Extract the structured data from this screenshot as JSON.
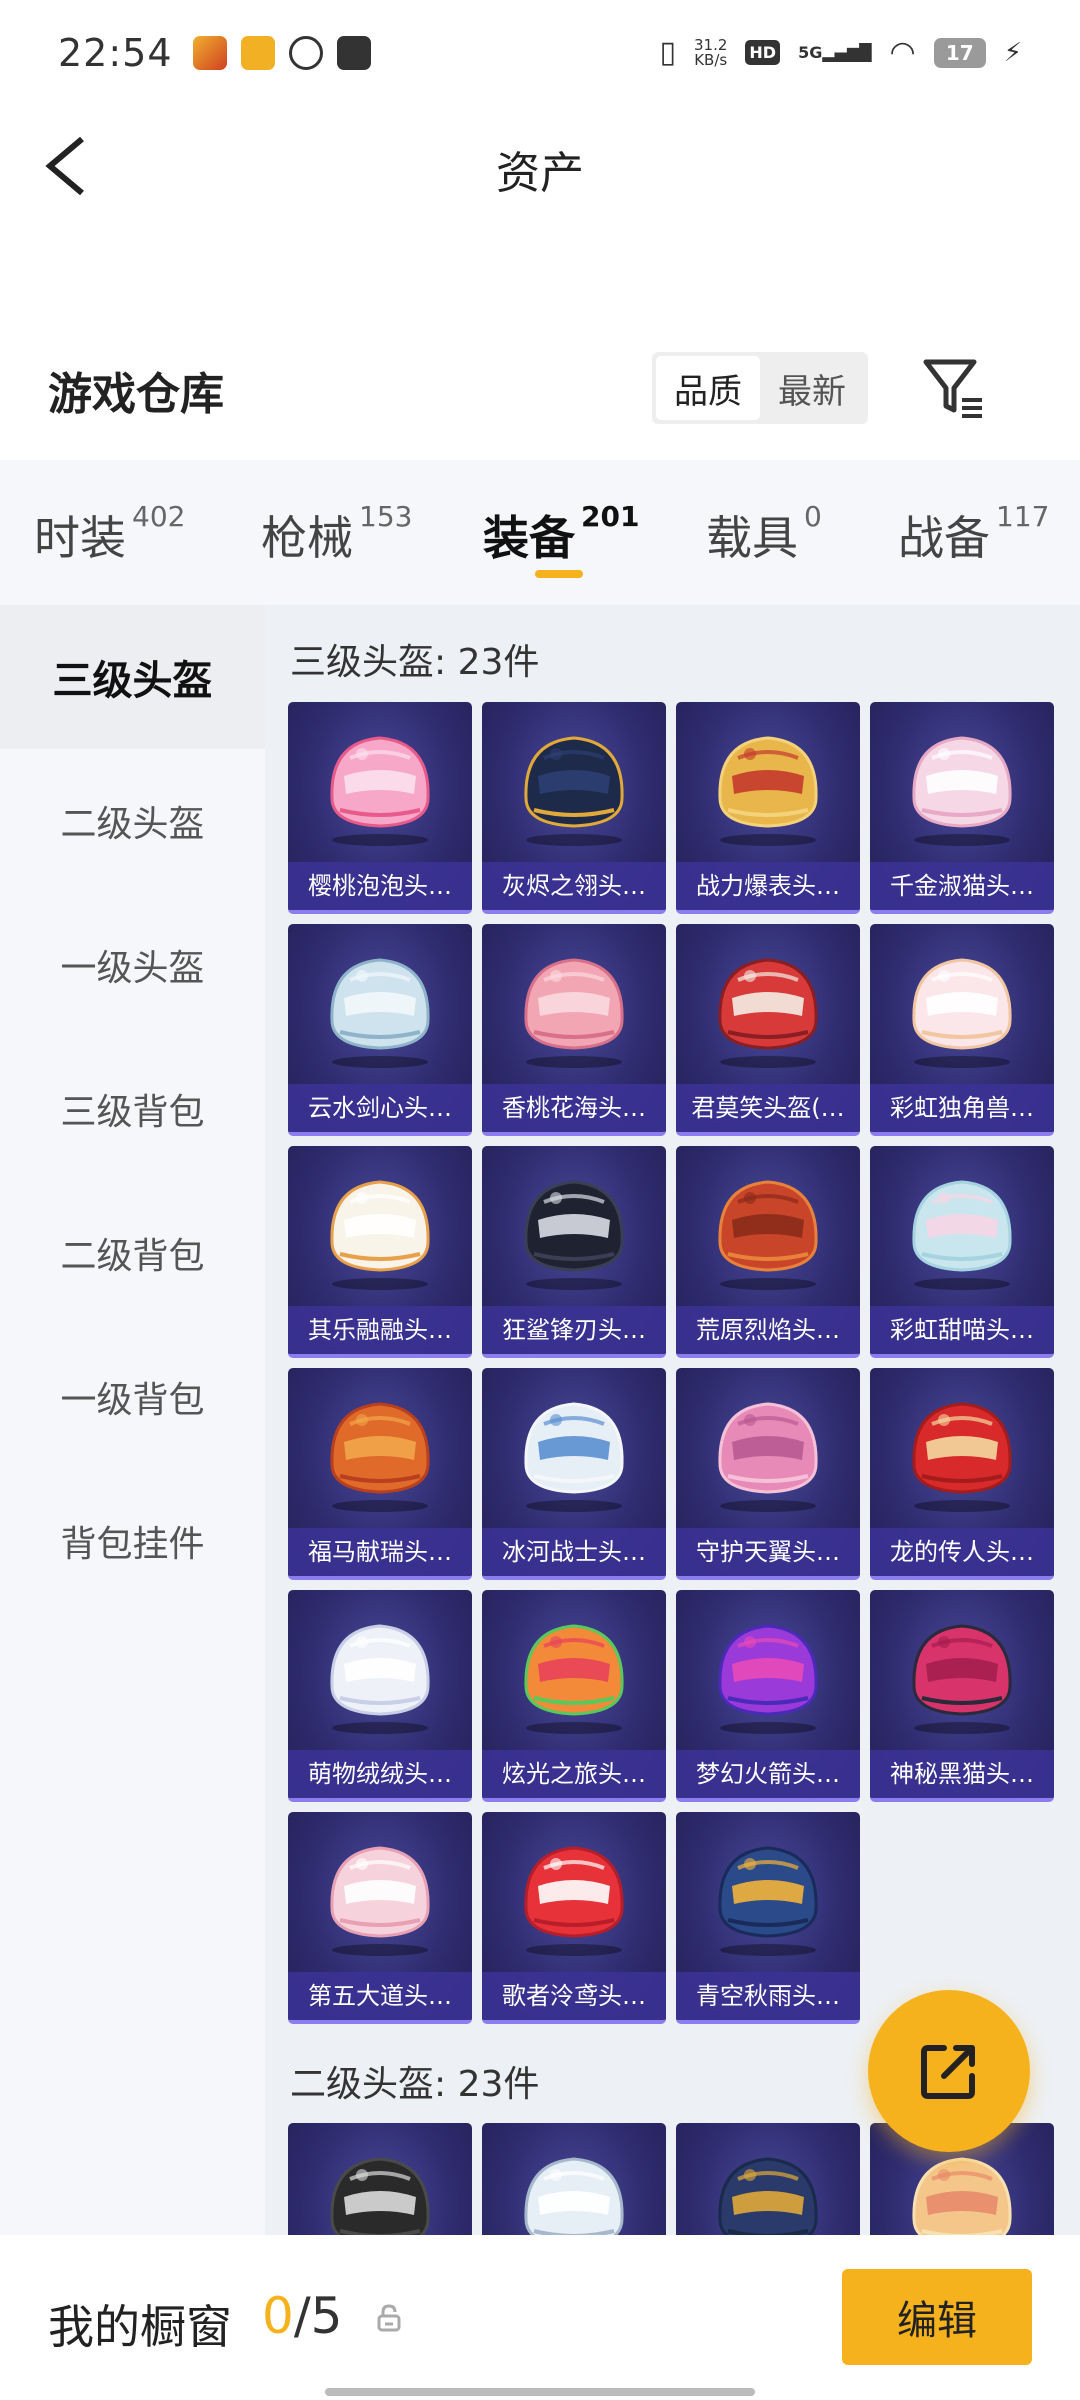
{
  "status_bar": {
    "time": "22:54",
    "net_speed_value": "31.2",
    "net_speed_unit": "KB/s",
    "hd_label": "HD",
    "signal_label": "5G",
    "battery_level": "17"
  },
  "header": {
    "title": "资产"
  },
  "warehouse": {
    "title": "游戏仓库",
    "sort_options": [
      "品质",
      "最新"
    ],
    "sort_selected": "品质"
  },
  "category_tabs": [
    {
      "label": "时装",
      "count": "402"
    },
    {
      "label": "枪械",
      "count": "153"
    },
    {
      "label": "装备",
      "count": "201"
    },
    {
      "label": "载具",
      "count": "0"
    },
    {
      "label": "战备",
      "count": "117"
    }
  ],
  "active_category": "装备",
  "sidebar": {
    "items": [
      "三级头盔",
      "二级头盔",
      "一级头盔",
      "三级背包",
      "二级背包",
      "一级背包",
      "背包挂件"
    ],
    "active": "三级头盔"
  },
  "sections": [
    {
      "title": "三级头盔: 23件",
      "items": [
        {
          "name": "樱桃泡泡头…",
          "colors": [
            "#f7a8c8",
            "#fbe0ec",
            "#e85a8a"
          ]
        },
        {
          "name": "灰烬之翎头…",
          "colors": [
            "#1d2a4a",
            "#2d3f72",
            "#e0a93a"
          ]
        },
        {
          "name": "战力爆表头…",
          "colors": [
            "#e8b64a",
            "#c43a2e",
            "#f4d27a"
          ]
        },
        {
          "name": "千金淑猫头…",
          "colors": [
            "#f6d7e6",
            "#ffffff",
            "#e8a9c4"
          ]
        },
        {
          "name": "云水剑心头…",
          "colors": [
            "#cfe3ef",
            "#f1f7fb",
            "#8fb3c9"
          ]
        },
        {
          "name": "香桃花海头…",
          "colors": [
            "#f2a6b4",
            "#fbd9df",
            "#d8708a"
          ]
        },
        {
          "name": "君莫笑头盔(…",
          "colors": [
            "#d83a3a",
            "#f4ede4",
            "#8a1e22"
          ]
        },
        {
          "name": "彩虹独角兽…",
          "colors": [
            "#fbe6ea",
            "#ffffff",
            "#f2c6a0"
          ]
        },
        {
          "name": "其乐融融头…",
          "colors": [
            "#f8f4ea",
            "#ffffff",
            "#e8a04a"
          ]
        },
        {
          "name": "狂鲨锋刃头…",
          "colors": [
            "#1f2230",
            "#d9dde6",
            "#3a3f55"
          ]
        },
        {
          "name": "荒原烈焰头…",
          "colors": [
            "#c8452a",
            "#8a2a1a",
            "#e8823a"
          ]
        },
        {
          "name": "彩虹甜喵头…",
          "colors": [
            "#c9e6ee",
            "#f6d6e6",
            "#a5d3e0"
          ]
        },
        {
          "name": "福马献瑞头…",
          "colors": [
            "#e06a2a",
            "#f2a64a",
            "#b8401e"
          ]
        },
        {
          "name": "冰河战士头…",
          "colors": [
            "#e6eef6",
            "#5a8fd0",
            "#f4f6f9"
          ]
        },
        {
          "name": "守护天翼头…",
          "colors": [
            "#e88ab8",
            "#b85a92",
            "#f4c1d8"
          ]
        },
        {
          "name": "龙的传人头…",
          "colors": [
            "#d82a2a",
            "#f4d9a0",
            "#a51c1c"
          ]
        },
        {
          "name": "萌物绒绒头…",
          "colors": [
            "#eef1f8",
            "#ffffff",
            "#c8cfe6"
          ]
        },
        {
          "name": "炫光之旅头…",
          "colors": [
            "#f28a3a",
            "#e8425a",
            "#5ac85a"
          ]
        },
        {
          "name": "梦幻火箭头…",
          "colors": [
            "#9a3ad8",
            "#e84ab8",
            "#4a2ab8"
          ]
        },
        {
          "name": "神秘黑猫头…",
          "colors": [
            "#d8336a",
            "#a51e4e",
            "#2a2a3a"
          ]
        },
        {
          "name": "第五大道头…",
          "colors": [
            "#f6d2dc",
            "#ffffff",
            "#e8a0b4"
          ]
        },
        {
          "name": "歌者泠鸢头…",
          "colors": [
            "#e8323a",
            "#ffffff",
            "#b81e2a"
          ]
        },
        {
          "name": "青空秋雨头…",
          "colors": [
            "#2a4a8a",
            "#f2b23a",
            "#1a2a5a"
          ]
        }
      ]
    },
    {
      "title": "二级头盔: 23件",
      "items": [
        {
          "name": "",
          "colors": [
            "#2a2a2a",
            "#dcdcdc",
            "#4a4a4a"
          ]
        },
        {
          "name": "",
          "colors": [
            "#e6eef6",
            "#ffffff",
            "#a8b8cc"
          ]
        },
        {
          "name": "",
          "colors": [
            "#2a3a6a",
            "#e0a93a",
            "#1a2a4a"
          ]
        },
        {
          "name": "",
          "colors": [
            "#f4c68a",
            "#e88a6a",
            "#f8e0b0"
          ]
        }
      ]
    }
  ],
  "shop_window": {
    "title": "我的橱窗",
    "current": "0",
    "separator": "/",
    "max": "5",
    "edit_label": "编辑"
  }
}
